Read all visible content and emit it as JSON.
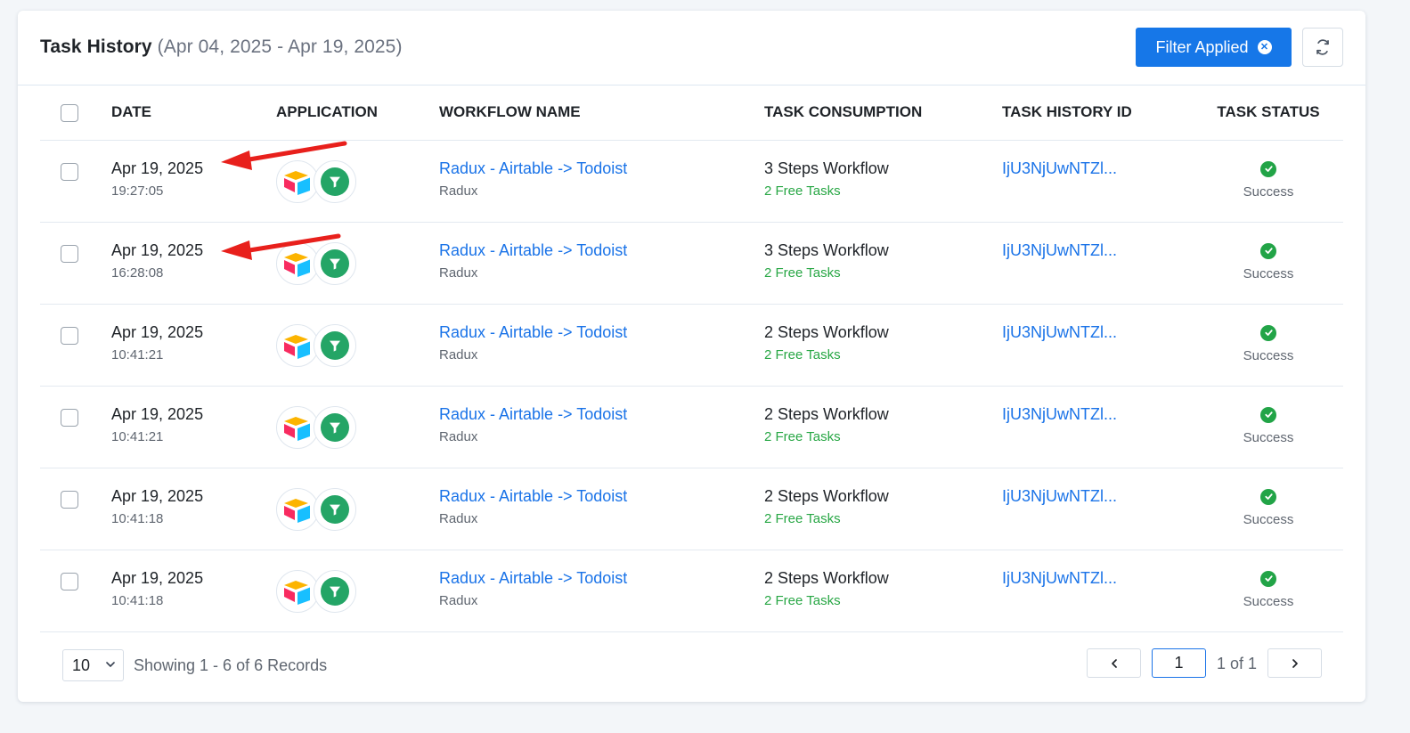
{
  "header": {
    "title": "Task History",
    "date_range": "(Apr 04, 2025 - Apr 19, 2025)",
    "filter_label": "Filter Applied",
    "filter_clear_icon": "x-circle-icon",
    "refresh_icon": "refresh-icon"
  },
  "columns": {
    "date": "DATE",
    "application": "APPLICATION",
    "workflow_name": "WORKFLOW NAME",
    "task_consumption": "TASK CONSUMPTION",
    "task_history_id": "TASK HISTORY ID",
    "task_status": "TASK STATUS"
  },
  "rows": [
    {
      "date": "Apr 19, 2025",
      "time": "19:27:05",
      "apps": [
        "airtable-icon",
        "filter-icon"
      ],
      "workflow": "Radux - Airtable -> Todoist",
      "workflow_owner": "Radux",
      "consumption": "3 Steps Workflow",
      "consumption_note": "2 Free Tasks",
      "history_id": "IjU3NjUwNTZl...",
      "status": "Success"
    },
    {
      "date": "Apr 19, 2025",
      "time": "16:28:08",
      "apps": [
        "airtable-icon",
        "filter-icon"
      ],
      "workflow": "Radux - Airtable -> Todoist",
      "workflow_owner": "Radux",
      "consumption": "3 Steps Workflow",
      "consumption_note": "2 Free Tasks",
      "history_id": "IjU3NjUwNTZl...",
      "status": "Success"
    },
    {
      "date": "Apr 19, 2025",
      "time": "10:41:21",
      "apps": [
        "airtable-icon",
        "filter-icon"
      ],
      "workflow": "Radux - Airtable -> Todoist",
      "workflow_owner": "Radux",
      "consumption": "2 Steps Workflow",
      "consumption_note": "2 Free Tasks",
      "history_id": "IjU3NjUwNTZl...",
      "status": "Success"
    },
    {
      "date": "Apr 19, 2025",
      "time": "10:41:21",
      "apps": [
        "airtable-icon",
        "filter-icon"
      ],
      "workflow": "Radux - Airtable -> Todoist",
      "workflow_owner": "Radux",
      "consumption": "2 Steps Workflow",
      "consumption_note": "2 Free Tasks",
      "history_id": "IjU3NjUwNTZl...",
      "status": "Success"
    },
    {
      "date": "Apr 19, 2025",
      "time": "10:41:18",
      "apps": [
        "airtable-icon",
        "filter-icon"
      ],
      "workflow": "Radux - Airtable -> Todoist",
      "workflow_owner": "Radux",
      "consumption": "2 Steps Workflow",
      "consumption_note": "2 Free Tasks",
      "history_id": "IjU3NjUwNTZl...",
      "status": "Success"
    },
    {
      "date": "Apr 19, 2025",
      "time": "10:41:18",
      "apps": [
        "airtable-icon",
        "filter-icon"
      ],
      "workflow": "Radux - Airtable -> Todoist",
      "workflow_owner": "Radux",
      "consumption": "2 Steps Workflow",
      "consumption_note": "2 Free Tasks",
      "history_id": "IjU3NjUwNTZl...",
      "status": "Success"
    }
  ],
  "footer": {
    "per_page": "10",
    "records_text": "Showing 1 - 6 of 6 Records",
    "current_page": "1",
    "page_of": "1 of 1"
  },
  "colors": {
    "accent": "#1677e8",
    "link": "#1a73e8",
    "success": "#22a447",
    "free_tasks": "#28a745",
    "annotation_arrow": "#e8201c"
  }
}
